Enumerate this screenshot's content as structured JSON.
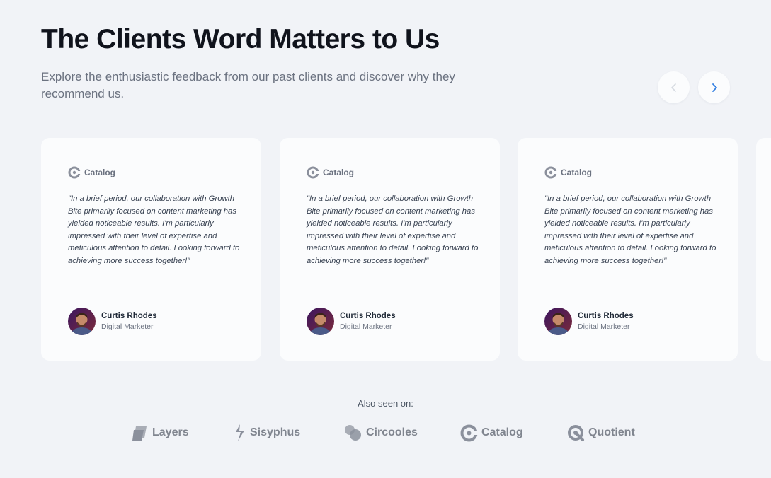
{
  "header": {
    "title": "The Clients Word Matters to Us",
    "subtitle": "Explore the enthusiastic feedback from our past clients and discover why they recommend us."
  },
  "carousel": {
    "prev_icon": "chevron-left-icon",
    "next_icon": "chevron-right-icon",
    "cards": [
      {
        "brand": "Catalog",
        "quote": "\"In a brief period, our collaboration with Growth Bite primarily focused on content marketing has yielded noticeable results. I'm particularly impressed with their level of expertise and meticulous attention to detail. Looking forward to achieving more success together!\"",
        "author_name": "Curtis Rhodes",
        "author_role": "Digital Marketer"
      },
      {
        "brand": "Catalog",
        "quote": "\"In a brief period, our collaboration with Growth Bite primarily focused on content marketing has yielded noticeable results. I'm particularly impressed with their level of expertise and meticulous attention to detail. Looking forward to achieving more success together!\"",
        "author_name": "Curtis Rhodes",
        "author_role": "Digital Marketer"
      },
      {
        "brand": "Catalog",
        "quote": "\"In a brief period, our collaboration with Growth Bite primarily focused on content marketing has yielded noticeable results. I'm particularly impressed with their level of expertise and meticulous attention to detail. Looking forward to achieving more success together!\"",
        "author_name": "Curtis Rhodes",
        "author_role": "Digital Marketer"
      }
    ]
  },
  "also_seen": {
    "label": "Also seen on:",
    "logos": [
      "Layers",
      "Sisyphus",
      "Circooles",
      "Catalog",
      "Quotient"
    ]
  },
  "colors": {
    "background": "#f1f3f7",
    "card": "#fbfcfd",
    "accent": "#2f7de1",
    "logo_gray": "#80858f"
  }
}
